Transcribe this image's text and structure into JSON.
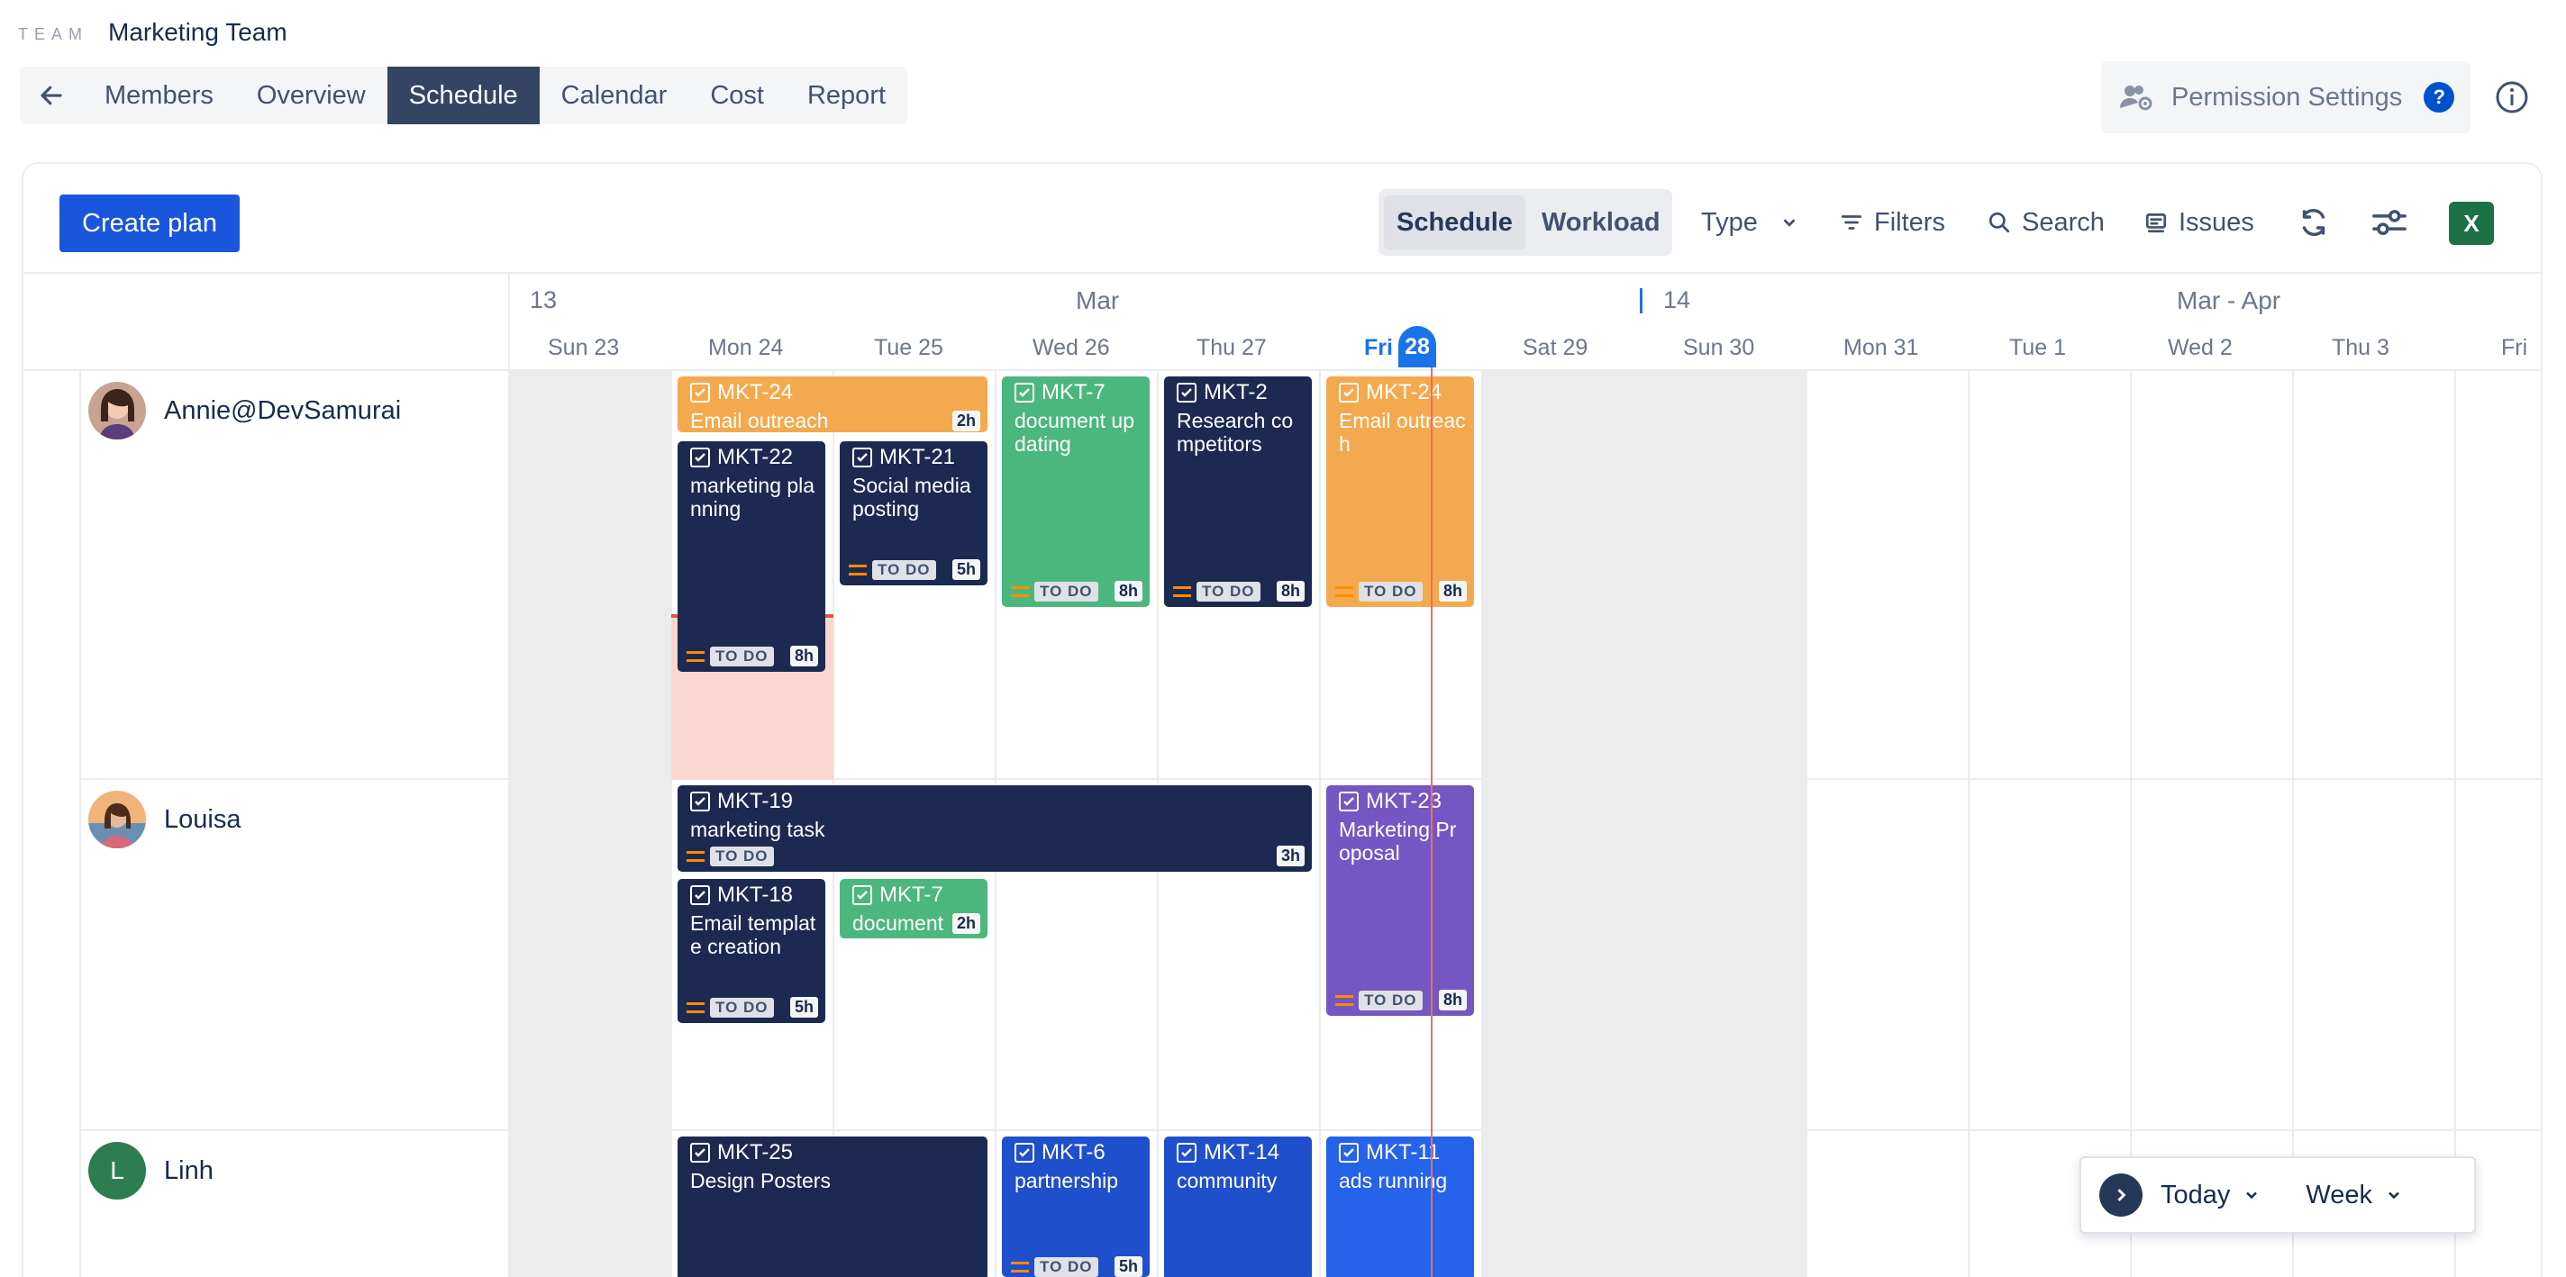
{
  "header": {
    "team_label": "TEAM",
    "team_name": "Marketing Team",
    "tabs": [
      {
        "label": "Members"
      },
      {
        "label": "Overview"
      },
      {
        "label": "Schedule",
        "active": true
      },
      {
        "label": "Calendar"
      },
      {
        "label": "Cost"
      },
      {
        "label": "Report"
      }
    ],
    "permission_settings": "Permission Settings",
    "help": "?"
  },
  "toolbar": {
    "create_plan": "Create plan",
    "view_schedule": "Schedule",
    "view_workload": "Workload",
    "type": "Type",
    "filters": "Filters",
    "search": "Search",
    "issues": "Issues",
    "excel": "X"
  },
  "timeline": {
    "week1": "13",
    "month1": "Mar",
    "week2": "14",
    "month2": "Mar - Apr",
    "days": [
      {
        "label": "Sun  23"
      },
      {
        "label": "Mon  24"
      },
      {
        "label": "Tue  25"
      },
      {
        "label": "Wed  26"
      },
      {
        "label": "Thu  27"
      },
      {
        "label": "Fri"
      },
      {
        "label": "Sat  29"
      },
      {
        "label": "Sun  30"
      },
      {
        "label": "Mon  31"
      },
      {
        "label": "Tue   1"
      },
      {
        "label": "Wed   2"
      },
      {
        "label": "Thu   3"
      },
      {
        "label": "Fri"
      }
    ],
    "today_num": "28"
  },
  "users": [
    {
      "name": "Annie@DevSamurai"
    },
    {
      "name": "Louisa"
    },
    {
      "name": "Linh",
      "initial": "L"
    }
  ],
  "tasks": [
    {
      "key": "MKT-24",
      "title": "Email outreach",
      "hours": "2h"
    },
    {
      "key": "MKT-22",
      "title": "marketing planning",
      "status": "TO DO",
      "hours": "8h"
    },
    {
      "key": "MKT-21",
      "title": "Social media posting",
      "status": "TO DO",
      "hours": "5h"
    },
    {
      "key": "MKT-7",
      "title": "document updating",
      "status": "TO DO",
      "hours": "8h"
    },
    {
      "key": "MKT-2",
      "title": "Research competitors",
      "status": "TO DO",
      "hours": "8h"
    },
    {
      "key": "MKT-24",
      "title": "Email outreach",
      "status": "TO DO",
      "hours": "8h"
    },
    {
      "key": "MKT-19",
      "title": "marketing task",
      "status": "TO DO",
      "hours": "3h"
    },
    {
      "key": "MKT-23",
      "title": "Marketing Proposal",
      "status": "TO DO",
      "hours": "8h"
    },
    {
      "key": "MKT-18",
      "title": "Email template creation",
      "status": "TO DO",
      "hours": "5h"
    },
    {
      "key": "MKT-7",
      "title": "document",
      "hours": "2h"
    },
    {
      "key": "MKT-25",
      "title": "Design Posters"
    },
    {
      "key": "MKT-6",
      "title": "partnership",
      "status": "TO DO",
      "hours": "5h"
    },
    {
      "key": "MKT-14",
      "title": "community"
    },
    {
      "key": "MKT-11",
      "title": "ads running"
    }
  ],
  "footer_controls": {
    "today": "Today",
    "range": "Week"
  },
  "colors": {
    "navy": "#1c2951",
    "orange": "#f4a94e",
    "green": "#4cb77c",
    "purple": "#7457c2",
    "blue": "#1f4fcc",
    "primary": "#1a56db",
    "today": "#1a73e8"
  }
}
